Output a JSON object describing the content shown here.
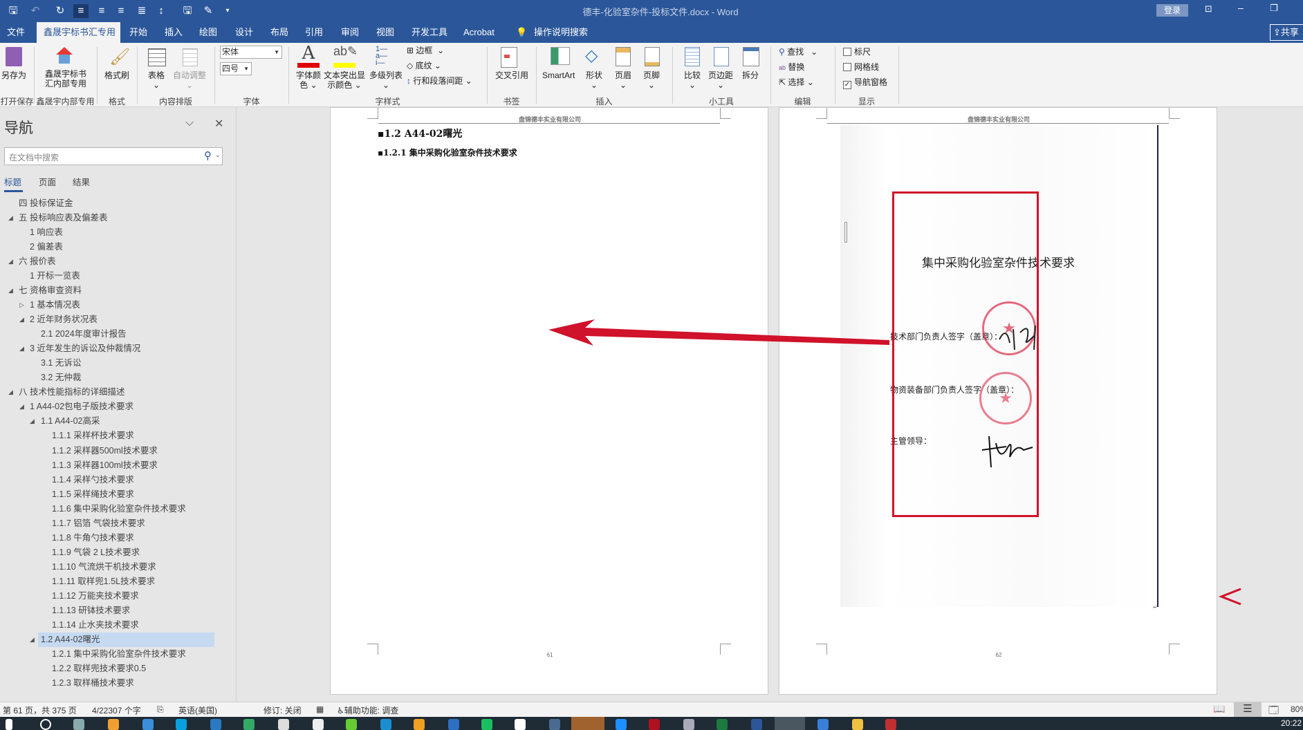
{
  "titlebar": {
    "title": "德丰-化验室杂件-投标文件.docx  -  Word",
    "login": "登录",
    "share": "共享"
  },
  "tabs": [
    "文件",
    "鑫晟宇标书汇专用",
    "开始",
    "插入",
    "绘图",
    "设计",
    "布局",
    "引用",
    "审阅",
    "视图",
    "开发工具",
    "Acrobat",
    "操作说明搜索"
  ],
  "ribbon": {
    "save_as": "另存为",
    "group_save": "打开保存",
    "xsy_line1": "鑫晟宇标书",
    "xsy_line2": "汇内部专用",
    "group_xsy": "鑫晟宇内部专用",
    "format_painter": "格式刷",
    "group_format": "格式",
    "table": "表格",
    "autofit": "自动调整",
    "group_layout": "内容排版",
    "font_name": "宋体",
    "font_size": "四号",
    "group_font": "字体",
    "font_color_1": "字体颜",
    "font_color_2": "色",
    "highlight_1": "文本突出显",
    "highlight_2": "示颜色",
    "multilevel": "多级列表",
    "border": "边框",
    "shading": "底纹",
    "spacing": "行和段落间距",
    "group_style": "字样式",
    "cross_ref": "交叉引用",
    "group_bookmark": "书签",
    "smartart": "SmartArt",
    "shapes": "形状",
    "header": "页眉",
    "footer": "页脚",
    "group_insert": "插入",
    "compare": "比较",
    "margins": "页边距",
    "split": "拆分",
    "group_tools": "小工具",
    "find": "查找",
    "replace": "替换",
    "select": "选择",
    "group_edit": "编辑",
    "ruler": "标尺",
    "gridlines": "网格线",
    "nav_pane": "导航窗格",
    "group_show": "显示",
    "colors": {
      "font_color": "#e00000",
      "highlight": "#ffff00",
      "accent": "#2b579a"
    }
  },
  "nav": {
    "title": "导航",
    "search_placeholder": "在文档中搜索",
    "tabs": [
      "标题",
      "页面",
      "结果"
    ],
    "items": [
      {
        "label": "四 投标保证金",
        "level": 0,
        "state": "none"
      },
      {
        "label": "五 投标响应表及偏差表",
        "level": 0,
        "state": "expanded"
      },
      {
        "label": "1 响应表",
        "level": 1,
        "state": "none"
      },
      {
        "label": "2 偏差表",
        "level": 1,
        "state": "none"
      },
      {
        "label": "六 报价表",
        "level": 0,
        "state": "expanded"
      },
      {
        "label": "1 开标一览表",
        "level": 1,
        "state": "none"
      },
      {
        "label": "七 资格审查资料",
        "level": 0,
        "state": "expanded"
      },
      {
        "label": "1 基本情况表",
        "level": 1,
        "state": "collapsed"
      },
      {
        "label": "2 近年财务状况表",
        "level": 1,
        "state": "expanded"
      },
      {
        "label": "2.1 2024年度审计报告",
        "level": 2,
        "state": "none"
      },
      {
        "label": "3 近年发生的诉讼及仲裁情况",
        "level": 1,
        "state": "expanded"
      },
      {
        "label": "3.1 无诉讼",
        "level": 2,
        "state": "none"
      },
      {
        "label": "3.2 无仲裁",
        "level": 2,
        "state": "none"
      },
      {
        "label": "八 技术性能指标的详细描述",
        "level": 0,
        "state": "expanded"
      },
      {
        "label": "1 A44-02包电子版技术要求",
        "level": 1,
        "state": "expanded"
      },
      {
        "label": "1.1 A44-02高采",
        "level": 2,
        "state": "expanded"
      },
      {
        "label": "1.1.1 采样杯技术要求",
        "level": 3,
        "state": "none"
      },
      {
        "label": "1.1.2 采样器500ml技术要求",
        "level": 3,
        "state": "none"
      },
      {
        "label": "1.1.3 采样器100ml技术要求",
        "level": 3,
        "state": "none"
      },
      {
        "label": "1.1.4 采样勺技术要求",
        "level": 3,
        "state": "none"
      },
      {
        "label": "1.1.5 采样绳技术要求",
        "level": 3,
        "state": "none"
      },
      {
        "label": "1.1.6 集中采购化验室杂件技术要求",
        "level": 3,
        "state": "none"
      },
      {
        "label": "1.1.7 铝箔 气袋技术要求",
        "level": 3,
        "state": "none"
      },
      {
        "label": "1.1.8 牛角勺技术要求",
        "level": 3,
        "state": "none"
      },
      {
        "label": "1.1.9 气袋 2 L技术要求",
        "level": 3,
        "state": "none"
      },
      {
        "label": "1.1.10 气流烘干机技术要求",
        "level": 3,
        "state": "none"
      },
      {
        "label": "1.1.11 取样兜1.5L技术要求",
        "level": 3,
        "state": "none"
      },
      {
        "label": "1.1.12 万能夹技术要求",
        "level": 3,
        "state": "none"
      },
      {
        "label": "1.1.13 研钵技术要求",
        "level": 3,
        "state": "none"
      },
      {
        "label": "1.1.14 止水夹技术要求",
        "level": 3,
        "state": "none"
      },
      {
        "label": "1.2 A44-02曙光",
        "level": 2,
        "state": "expanded",
        "selected": true
      },
      {
        "label": "1.2.1 集中采购化验室杂件技术要求",
        "level": 3,
        "state": "none"
      },
      {
        "label": "1.2.2 取样兜技术要求0.5",
        "level": 3,
        "state": "none"
      },
      {
        "label": "1.2.3 取样桶技术要求",
        "level": 3,
        "state": "none"
      }
    ]
  },
  "document": {
    "header_text": "盘锦德丰实业有限公司",
    "page1": {
      "heading2": "1.2 A44-02曙光",
      "heading3": "1.2.1 集中采购化验室杂件技术要求",
      "page_number": "61"
    },
    "page2": {
      "page_number": "62",
      "scan_title": "集中采购化验室杂件技术要求",
      "tech_sign": "技术部门负责人签字（盖章）：",
      "material_sign": "物资装备部门负责人签字（盖章）：",
      "leader_sign": "主管领导："
    }
  },
  "status": {
    "page": "第 61 页，共 375 页",
    "words": "4/22307 个字",
    "language": "英语(美国)",
    "track": "修订: 关闭",
    "accessibility": "辅助功能: 调查",
    "zoom": "80%"
  },
  "taskbar": {
    "clock": "20:22"
  }
}
